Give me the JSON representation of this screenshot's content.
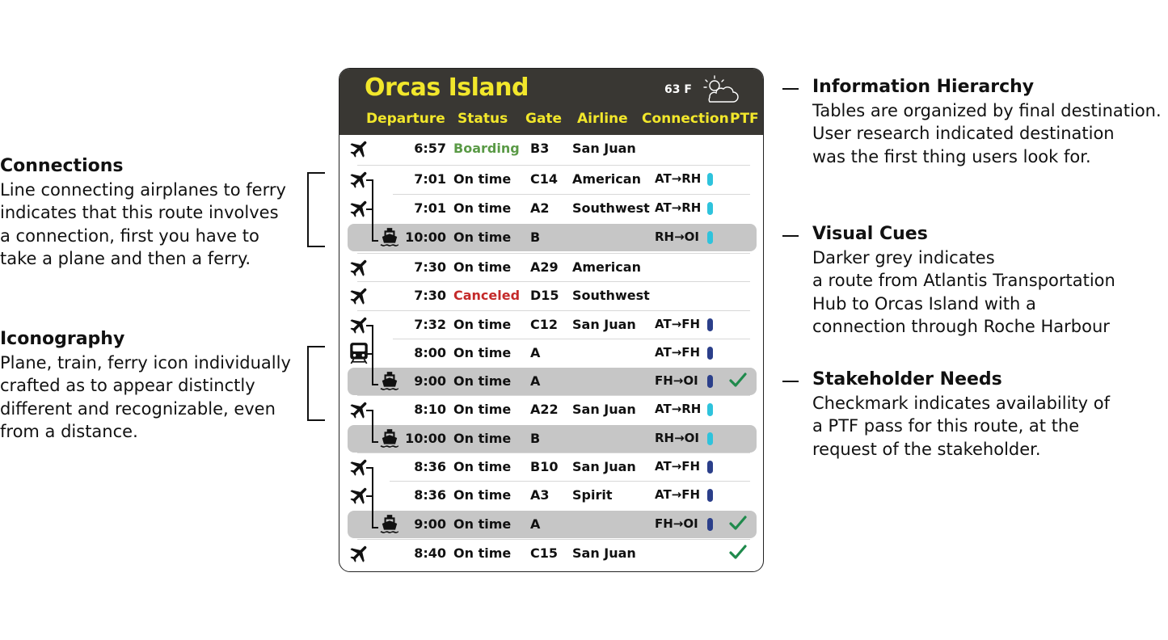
{
  "board": {
    "title": "Orcas Island",
    "temperature": "63 F",
    "weather_icon": "partly-sunny-icon",
    "columns": [
      "Departure",
      "Status",
      "Gate",
      "Airline",
      "Connection",
      "PTF"
    ],
    "colors": {
      "header_bg": "#393733",
      "header_text": "#f2e72b",
      "boarding": "#5a9a46",
      "canceled": "#c42a2a",
      "highlight_row": "#c6c6c6",
      "pill_cyan": "#2ec3dc",
      "pill_navy": "#2b3f8a",
      "check": "#1f8a4c"
    },
    "rows": [
      {
        "icon": "plane-icon",
        "time": "6:57",
        "status": "Boarding",
        "gate": "B3",
        "airline": "San Juan",
        "connection": "",
        "pill": "",
        "ptf": false
      },
      {
        "icon": "plane-icon",
        "time": "7:01",
        "status": "On time",
        "gate": "C14",
        "airline": "American",
        "connection": "AT→RH",
        "pill": "cyan",
        "ptf": false
      },
      {
        "icon": "plane-icon",
        "time": "7:01",
        "status": "On time",
        "gate": "A2",
        "airline": "Southwest",
        "connection": "AT→RH",
        "pill": "cyan",
        "ptf": false
      },
      {
        "icon": "ferry-icon",
        "time": "10:00",
        "status": "On time",
        "gate": "B",
        "airline": "",
        "connection": "RH→OI",
        "pill": "cyan",
        "ptf": false
      },
      {
        "icon": "plane-icon",
        "time": "7:30",
        "status": "On time",
        "gate": "A29",
        "airline": "American",
        "connection": "",
        "pill": "",
        "ptf": false
      },
      {
        "icon": "plane-icon",
        "time": "7:30",
        "status": "Canceled",
        "gate": "D15",
        "airline": "Southwest",
        "connection": "",
        "pill": "",
        "ptf": false
      },
      {
        "icon": "plane-icon",
        "time": "7:32",
        "status": "On time",
        "gate": "C12",
        "airline": "San Juan",
        "connection": "AT→FH",
        "pill": "navy",
        "ptf": false
      },
      {
        "icon": "train-icon",
        "time": "8:00",
        "status": "On time",
        "gate": "A",
        "airline": "",
        "connection": "AT→FH",
        "pill": "navy",
        "ptf": false
      },
      {
        "icon": "ferry-icon",
        "time": "9:00",
        "status": "On time",
        "gate": "A",
        "airline": "",
        "connection": "FH→OI",
        "pill": "navy",
        "ptf": true
      },
      {
        "icon": "plane-icon",
        "time": "8:10",
        "status": "On time",
        "gate": "A22",
        "airline": "San Juan",
        "connection": "AT→RH",
        "pill": "cyan",
        "ptf": false
      },
      {
        "icon": "ferry-icon",
        "time": "10:00",
        "status": "On time",
        "gate": "B",
        "airline": "",
        "connection": "RH→OI",
        "pill": "cyan",
        "ptf": false
      },
      {
        "icon": "plane-icon",
        "time": "8:36",
        "status": "On time",
        "gate": "B10",
        "airline": "San Juan",
        "connection": "AT→FH",
        "pill": "navy",
        "ptf": false
      },
      {
        "icon": "plane-icon",
        "time": "8:36",
        "status": "On time",
        "gate": "A3",
        "airline": "Spirit",
        "connection": "AT→FH",
        "pill": "navy",
        "ptf": false
      },
      {
        "icon": "ferry-icon",
        "time": "9:00",
        "status": "On time",
        "gate": "A",
        "airline": "",
        "connection": "FH→OI",
        "pill": "navy",
        "ptf": true
      },
      {
        "icon": "plane-icon",
        "time": "8:40",
        "status": "On time",
        "gate": "C15",
        "airline": "San Juan",
        "connection": "",
        "pill": "",
        "ptf": true
      }
    ]
  },
  "notes": {
    "connections": {
      "title": "Connections",
      "lines": [
        "Line connecting airplanes to ferry",
        "indicates that this route involves",
        "a connection, first you have to",
        "take a plane and then a ferry."
      ]
    },
    "iconography": {
      "title": "Iconography",
      "lines": [
        "Plane, train, ferry icon individually",
        "crafted as to appear distinctly",
        "different and recognizable, even",
        "from a distance."
      ]
    },
    "information_hierarchy": {
      "title": "Information Hierarchy",
      "lines": [
        "Tables are organized by final destination.",
        "User research indicated destination",
        "was the first thing users look for."
      ]
    },
    "visual_cues": {
      "title": "Visual Cues",
      "lines": [
        "Darker grey indicates",
        "a route from Atlantis Transportation",
        "Hub to Orcas Island with a",
        "connection through Roche Harbour"
      ]
    },
    "stakeholder_needs": {
      "title": "Stakeholder Needs",
      "lines": [
        "Checkmark indicates availability of",
        "a PTF pass for this route, at the",
        "request of the stakeholder."
      ]
    }
  }
}
